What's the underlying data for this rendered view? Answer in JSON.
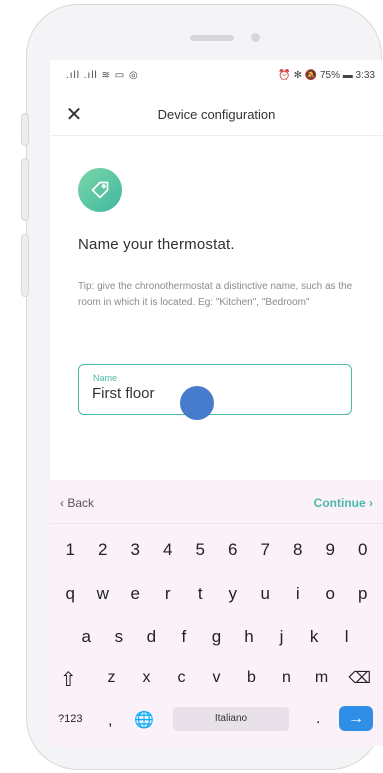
{
  "status_bar": {
    "left_icons": ".ıll .ıll ≋ ▭ ◎",
    "right_text": "⏰ ✻ 🔕 75% ▬ 3:33"
  },
  "header": {
    "close_icon": "close-icon",
    "title": "Device configuration"
  },
  "content": {
    "icon": "tag-icon",
    "heading": "Name your thermostat.",
    "tip": "Tip: give the chronothermostat a distinctive name, such as the room in which it is located. Eg: \"Kitchen\", \"Bedroom\""
  },
  "field": {
    "label": "Name",
    "value": "First floor"
  },
  "keyboard_bar": {
    "back": "‹  Back",
    "continue": "Continue  ›"
  },
  "keyboard": {
    "row1": [
      "1",
      "2",
      "3",
      "4",
      "5",
      "6",
      "7",
      "8",
      "9",
      "0"
    ],
    "row2": [
      "q",
      "w",
      "e",
      "r",
      "t",
      "y",
      "u",
      "i",
      "o",
      "p"
    ],
    "row3": [
      "a",
      "s",
      "d",
      "f",
      "g",
      "h",
      "j",
      "k",
      "l"
    ],
    "row4": [
      "z",
      "x",
      "c",
      "v",
      "b",
      "n",
      "m"
    ],
    "shift": "⇧",
    "delete": "⌫",
    "symbols": "?123",
    "comma": ",",
    "globe": "🌐",
    "space": "Italiano",
    "dot": ".",
    "enter": "→"
  },
  "colors": {
    "accent": "#4cb9a6",
    "enter": "#2f8ee6",
    "touch": "#3d74c9"
  }
}
